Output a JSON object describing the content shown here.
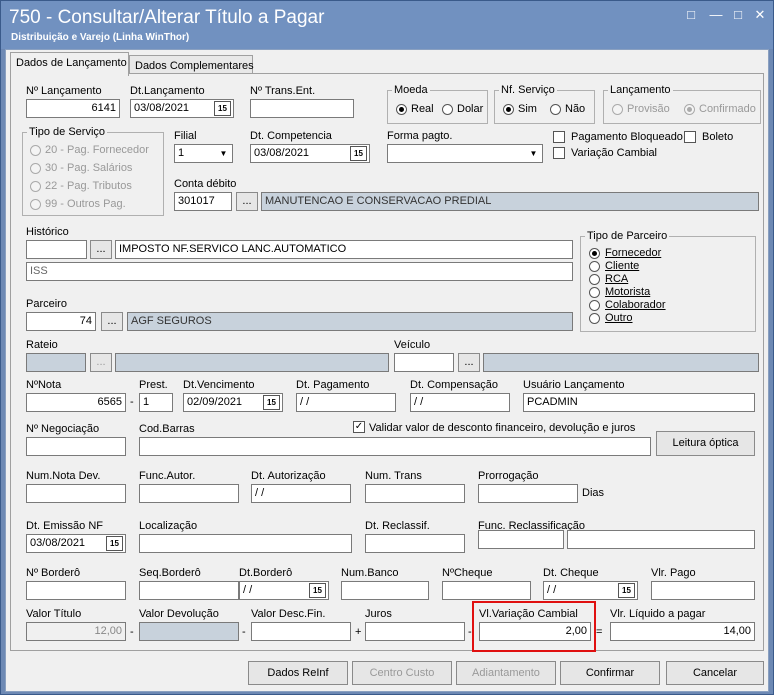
{
  "window": {
    "title": "750 - Consultar/Alterar Título a Pagar",
    "subtitle": "Distribuição e Varejo (Linha WinThor)",
    "restore_icon": "□",
    "min_icon": "—",
    "max_icon": "□",
    "close_icon": "✕"
  },
  "tabs": [
    "Dados de Lançamento",
    "Dados Complementares"
  ],
  "labels": {
    "n_lancamento": "Nº Lançamento",
    "dt_lancamento": "Dt.Lançamento",
    "n_trans_ent": "Nº Trans.Ent.",
    "tipo_servico": "Tipo de Serviço",
    "filial": "Filial",
    "dt_competencia": "Dt. Competencia",
    "forma_pagto": "Forma pagto.",
    "conta_debito": "Conta débito",
    "historico": "Histórico",
    "parceiro": "Parceiro",
    "rateio": "Rateio",
    "veiculo": "Veículo",
    "n_nota": "NºNota",
    "prest": "Prest.",
    "dt_vencimento": "Dt.Vencimento",
    "dt_pagamento": "Dt. Pagamento",
    "dt_compensacao": "Dt. Compensação",
    "usuario_lancamento": "Usuário Lançamento",
    "n_negociacao": "Nº Negociação",
    "cod_barras": "Cod.Barras",
    "validar": "Validar valor de desconto financeiro,  devolução e juros",
    "num_nota_dev": "Num.Nota Dev.",
    "func_autor": "Func.Autor.",
    "dt_autorizacao": "Dt. Autorização",
    "num_trans": "Num. Trans",
    "prorrogacao": "Prorrogação",
    "dias": "Dias",
    "dt_emissao_nf": "Dt. Emissão NF",
    "localizacao": "Localização",
    "dt_reclassif": "Dt. Reclassif.",
    "func_reclassificacao": "Func. Reclassificação",
    "n_bordero": "Nº Borderô",
    "seq_bordero": "Seq.Borderô",
    "dt_bordero": "Dt.Borderô",
    "num_banco": "Num.Banco",
    "n_cheque": "NºCheque",
    "dt_cheque": "Dt. Cheque",
    "vl_pago": "Vlr. Pago",
    "valor_titulo": "Valor Título",
    "valor_devolucao": "Valor Devolução",
    "valor_desc_fin": "Valor Desc.Fin.",
    "juros": "Juros",
    "vl_variacao_cambial": "Vl.Variação Cambial",
    "vlr_liquido": "Vlr. Líquido a pagar"
  },
  "values": {
    "n_lancamento": "6141",
    "dt_lancamento": "03/08/2021",
    "n_trans_ent": "",
    "filial": "1",
    "dt_competencia": "03/08/2021",
    "forma_pagto": "",
    "conta_debito": "301017",
    "conta_debito_desc": "MANUTENCAO E CONSERVACAO PREDIAL",
    "historico_cod": "",
    "historico_desc": "IMPOSTO NF.SERVICO LANC.AUTOMATICO",
    "historico2": "ISS",
    "parceiro": "74",
    "parceiro_desc": "AGF SEGUROS",
    "n_nota": "6565",
    "prest": "1",
    "dt_vencimento": "02/09/2021",
    "dt_pagamento": " /  /",
    "dt_compensacao": " /  /",
    "usuario_lancamento": "PCADMIN",
    "dt_autorizacao": " /  /",
    "dt_emissao_nf": "03/08/2021",
    "dt_bordero": " /  /",
    "dt_cheque": " /  /",
    "valor_titulo": "12,00",
    "vl_variacao_cambial": "2,00",
    "vlr_liquido": "14,00"
  },
  "moeda": {
    "title": "Moeda",
    "options": [
      "Real",
      "Dolar"
    ],
    "selected": "Real"
  },
  "nf_servico": {
    "title": "Nf. Serviço",
    "options": [
      "Sim",
      "Não"
    ],
    "selected": "Sim"
  },
  "lancamento": {
    "title": "Lançamento",
    "options": [
      "Provisão",
      "Confirmado"
    ],
    "selected": "Confirmado"
  },
  "tipo_servico_options": [
    "20 - Pag. Fornecedor",
    "30 - Pag. Salários",
    "22 - Pag. Tributos",
    "99 - Outros Pag."
  ],
  "checks": {
    "pagamento_bloqueado": "Pagamento Bloqueado",
    "boleto": "Boleto",
    "variacao_cambial": "Variação Cambial"
  },
  "tipo_parceiro": {
    "title": "Tipo de Parceiro",
    "options": [
      "Fornecedor",
      "Cliente",
      "RCA",
      "Motorista",
      "Colaborador",
      "Outro"
    ],
    "selected": "Fornecedor"
  },
  "buttons": {
    "ellipsis": "...",
    "leitura_optica": "Leitura óptica",
    "dados_reinf": "Dados ReInf",
    "centro_custo": "Centro Custo",
    "adiantamento": "Adiantamento",
    "confirmar": "Confirmar",
    "cancelar": "Cancelar"
  },
  "symbols": {
    "dash": "-",
    "plus": "+",
    "equals": "=",
    "check": "✓",
    "down": "▼",
    "cal": "15"
  }
}
